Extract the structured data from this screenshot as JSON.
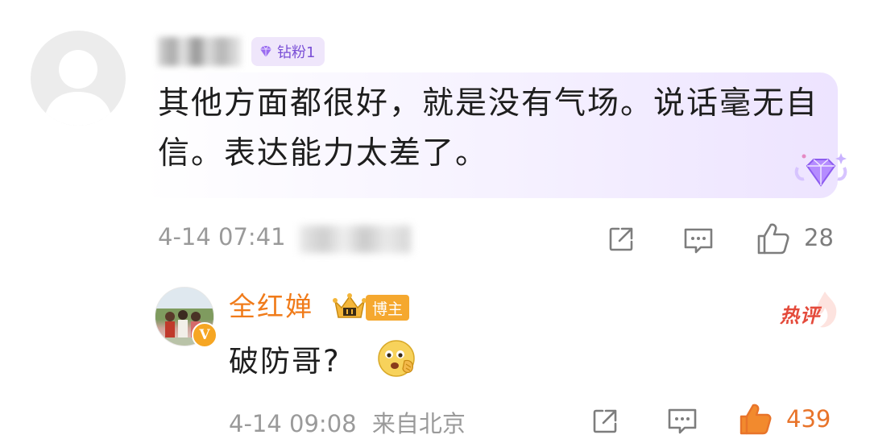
{
  "comment": {
    "username": "",
    "fan_badge": "钻粉1",
    "text": "其他方面都很好，就是没有气场。说话毫无自信。表达能力太差了。",
    "time": "4-14 07:41",
    "location": "",
    "like_count": "28"
  },
  "reply": {
    "username": "全红婵",
    "role_badge": "博主",
    "verified_mark": "V",
    "hot_label": "热评",
    "text": "破防哥?",
    "time": "4-14 09:08",
    "location": "来自北京",
    "like_count": "439"
  },
  "colors": {
    "accent_orange": "#f07b1a",
    "fan_purple": "#7a4fd6",
    "hot_red": "#e44a3b"
  },
  "icons": [
    "share-icon",
    "comment-icon",
    "thumbs-up-icon"
  ]
}
